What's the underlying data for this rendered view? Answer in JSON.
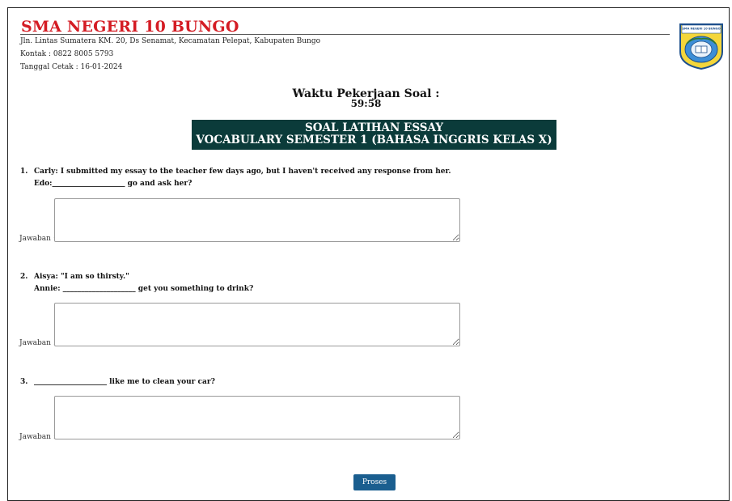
{
  "header": {
    "school_name": "SMA NEGERI 10 BUNGO",
    "address": "Jln. Lintas Sumatera KM. 20, Ds Senamat, Kecamatan Pelepat, Kabupaten Bungo",
    "contact": "Kontak : 0822 8005 5793",
    "print_date": "Tanggal Cetak : 16-01-2024",
    "logo_text": "SMA NEGERI 10 BUNGO"
  },
  "timer": {
    "title": "Waktu Pekerjaan Soal :",
    "value": "59:58"
  },
  "banner": {
    "line1": "SOAL LATIHAN ESSAY",
    "line2": "VOCABULARY SEMESTER 1 (BAHASA INGGRIS KELAS X)"
  },
  "answer_label": "Jawaban :",
  "questions": [
    {
      "number": "1.",
      "line1": "Carly: I submitted my essay to the teacher few days ago, but I haven't received any response from her.",
      "line2": "Edo:____________________ go and ask her?",
      "answer": ""
    },
    {
      "number": "2.",
      "line1": "Aisya: \"I am so thirsty.\"",
      "line2": "Annie: ____________________ get you something to drink?",
      "answer": ""
    },
    {
      "number": "3.",
      "line1": "____________________ like me to clean your car?",
      "answer": ""
    }
  ],
  "submit_label": "Proses",
  "colors": {
    "school_name": "#d41c24",
    "banner_bg": "#0b3b3a",
    "button_bg": "#1a5e8f"
  }
}
